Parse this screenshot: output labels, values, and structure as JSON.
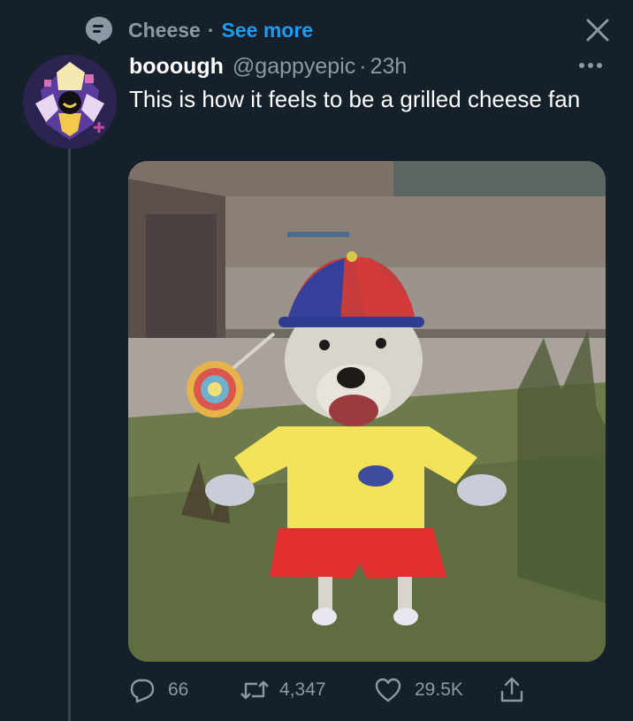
{
  "context": {
    "topic": "Cheese",
    "dot": "·",
    "see_more": "See more"
  },
  "tweet": {
    "display_name": "booough",
    "handle": "@gappyepic",
    "dot": "·",
    "time": "23h",
    "text": "This is how it feels to be a grilled cheese fan"
  },
  "actions": {
    "replies": "66",
    "retweets": "4,347",
    "likes": "29.5K"
  },
  "icons": {
    "topic": "topic-bubble-icon",
    "close": "close-icon",
    "more": "more-options-icon",
    "reply": "reply-icon",
    "retweet": "retweet-icon",
    "like": "heart-icon",
    "share": "share-icon"
  },
  "colors": {
    "background": "#15202b",
    "accent": "#1d9bf0",
    "secondary_text": "#8b98a5"
  }
}
